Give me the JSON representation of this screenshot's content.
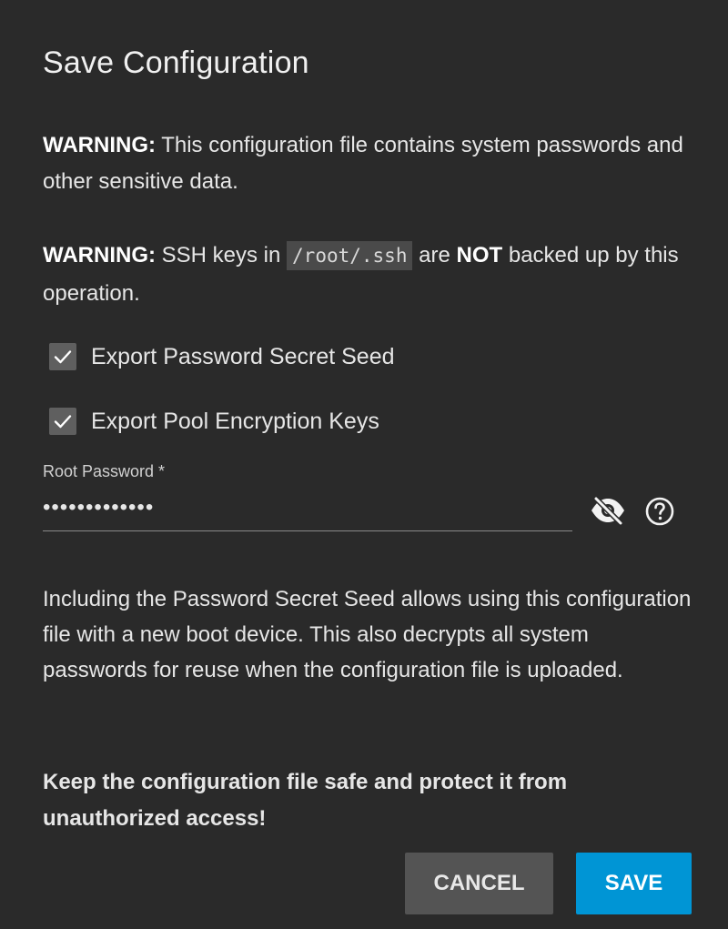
{
  "dialog": {
    "title": "Save Configuration",
    "warning1": {
      "label": "WARNING:",
      "text": " This configuration file contains system passwords and other sensitive data."
    },
    "warning2": {
      "label": "WARNING:",
      "text_before": " SSH keys in ",
      "code": "/root/.ssh",
      "text_middle": " are ",
      "emphasis": "NOT",
      "text_after": " backed up by this operation."
    },
    "checkboxes": [
      {
        "label": "Export Password Secret Seed",
        "checked": true
      },
      {
        "label": "Export Pool Encryption Keys",
        "checked": true
      }
    ],
    "password_field": {
      "label": "Root Password *",
      "value": "•••••••••••••"
    },
    "info_text": "Including the Password Secret Seed allows using this configuration file with a new boot device. This also decrypts all system passwords for reuse when the configuration file is uploaded.",
    "safety_note": "Keep the configuration file safe and protect it from unauthorized access!",
    "buttons": {
      "cancel": "CANCEL",
      "save": "SAVE"
    }
  },
  "colors": {
    "background": "#2a2a2a",
    "primary": "#0095d5",
    "cancel": "#545454"
  },
  "icons": {
    "visibility": "eye-off-icon",
    "help": "help-circle-icon",
    "checkbox": "check-icon"
  }
}
